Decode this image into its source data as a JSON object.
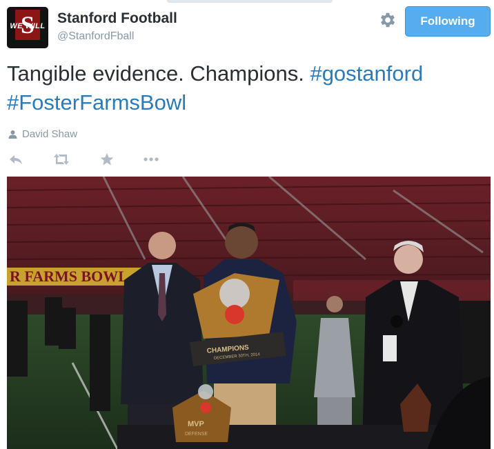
{
  "account": {
    "display_name": "Stanford Football",
    "handle": "@StanfordFball",
    "avatar_text": "WE WILL"
  },
  "header": {
    "follow_label": "Following",
    "settings_icon": "gear-icon"
  },
  "tweet": {
    "text_plain": "Tangible evidence. Champions.",
    "hashtags": [
      "#gostanford",
      "#FosterFarmsBowl"
    ],
    "author_credit": "David Shaw",
    "actions": [
      "reply-icon",
      "retweet-icon",
      "favorite-icon",
      "more-icon"
    ]
  },
  "photo": {
    "banner_text": "R FARMS BOWL",
    "trophy_plaque": "CHAMPIONS",
    "trophy_date": "DECEMBER 30TH, 2014",
    "mvp_plaque": "MVP",
    "mvp_sub": "DEFENSE"
  },
  "colors": {
    "follow_bg": "#55acee",
    "hashtag": "#2b7bb9",
    "muted": "#8899a6",
    "stanford_red": "#8c1515"
  }
}
